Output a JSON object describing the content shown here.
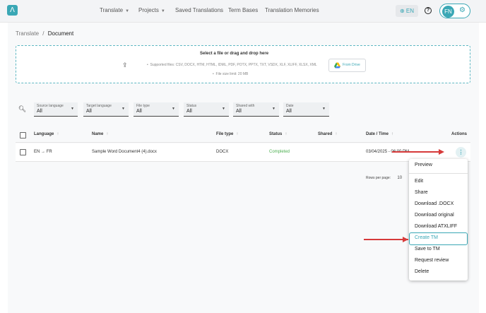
{
  "topbar": {
    "logo": "Λ",
    "nav": [
      {
        "label": "Translate",
        "has_chevron": true
      },
      {
        "label": "Projects",
        "has_chevron": true
      },
      {
        "label": "Saved Translations",
        "has_chevron": false
      },
      {
        "label": "Term Bases",
        "has_chevron": false
      },
      {
        "label": "Translation Memories",
        "has_chevron": false
      }
    ],
    "language": "EN",
    "help_icon": "?",
    "avatar_initials": "FN",
    "settings_icon": "gear-icon"
  },
  "breadcrumb": {
    "parent": "Translate",
    "separator": "/",
    "current": "Document"
  },
  "dropzone": {
    "title": "Select a file or drag and drop here",
    "supported": "Supported files: CSV, DOCX, HTM, HTML, IDML, PDF, POTX, PPTX, TXT, VSDX, XLF, XLIFF, XLSX, XML",
    "size_limit": "File size limit: 20 MB",
    "drive_button": "From Drive"
  },
  "filters": [
    {
      "label": "Source language",
      "value": "All"
    },
    {
      "label": "Target language",
      "value": "All"
    },
    {
      "label": "File type",
      "value": "All"
    },
    {
      "label": "Status",
      "value": "All"
    },
    {
      "label": "Shared with",
      "value": "All"
    },
    {
      "label": "Date",
      "value": "All"
    }
  ],
  "table": {
    "headers": {
      "language": "Language",
      "name": "Name",
      "file_type": "File type",
      "status": "Status",
      "shared": "Shared",
      "date": "Date / Time",
      "actions": "Actions"
    },
    "rows": [
      {
        "source": "EN",
        "target": "FR",
        "name": "Sample Word Document4 (4).docx",
        "file_type": "DOCX",
        "status": "Completed",
        "shared": "",
        "date": "03/04/2025 - 06:00 PM"
      }
    ]
  },
  "pagination": {
    "rows_per_page_label": "Rows per page:",
    "rows_per_page": "10"
  },
  "context_menu": {
    "items": [
      "Preview",
      "Edit",
      "Share",
      "Download .DOCX",
      "Download original",
      "Download ATXLIFF",
      "Create TM",
      "Save to TM",
      "Request review",
      "Delete"
    ],
    "highlighted": "Create TM"
  },
  "colors": {
    "accent": "#3aa7b5",
    "status_completed": "#4caf50",
    "annotation_arrow": "#d63a3a"
  }
}
